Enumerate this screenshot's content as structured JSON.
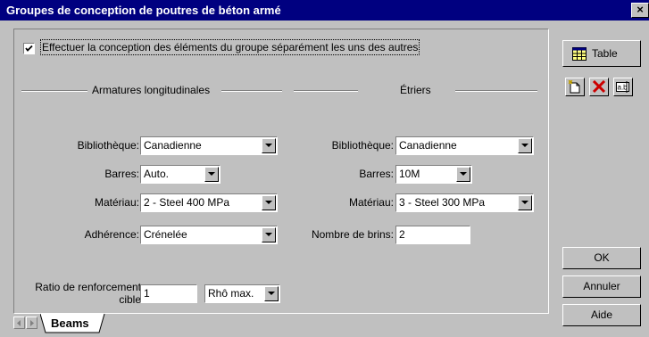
{
  "window": {
    "title": "Groupes de conception de poutres de béton armé",
    "close_glyph": "×"
  },
  "options": {
    "separate_design_label": "Effectuer la conception des éléments du groupe séparément les uns des autres",
    "separate_design_checked": true
  },
  "longitudinal": {
    "section_title": "Armatures longitudinales",
    "library_label": "Bibliothèque:",
    "library_value": "Canadienne",
    "bars_label": "Barres:",
    "bars_value": "Auto.",
    "material_label": "Matériau:",
    "material_value": "2 - Steel 400 MPa",
    "adherence_label": "Adhérence:",
    "adherence_value": "Crénelée"
  },
  "stirrups": {
    "section_title": "Étriers",
    "library_label": "Bibliothèque:",
    "library_value": "Canadienne",
    "bars_label": "Barres:",
    "bars_value": "10M",
    "material_label": "Matériau:",
    "material_value": "3 - Steel 300 MPa",
    "strands_label": "Nombre de brins:",
    "strands_value": "2"
  },
  "ratio": {
    "label_line1": "Ratio de renforcement",
    "label_line2": "cible",
    "value": "1",
    "type_value": "Rhô max."
  },
  "toolbar": {
    "table_label": "Table",
    "new_icon": "new-item-icon",
    "delete_icon": "delete-x-icon",
    "rename_icon": "rename-icon"
  },
  "buttons": {
    "ok_label": "OK",
    "cancel_label": "Annuler",
    "help_label": "Aide"
  },
  "tabs": [
    {
      "label": "Beams",
      "active": true
    }
  ],
  "colors": {
    "titlebar": "#000080",
    "face": "#c0c0c0",
    "delete_red": "#cc0000"
  }
}
